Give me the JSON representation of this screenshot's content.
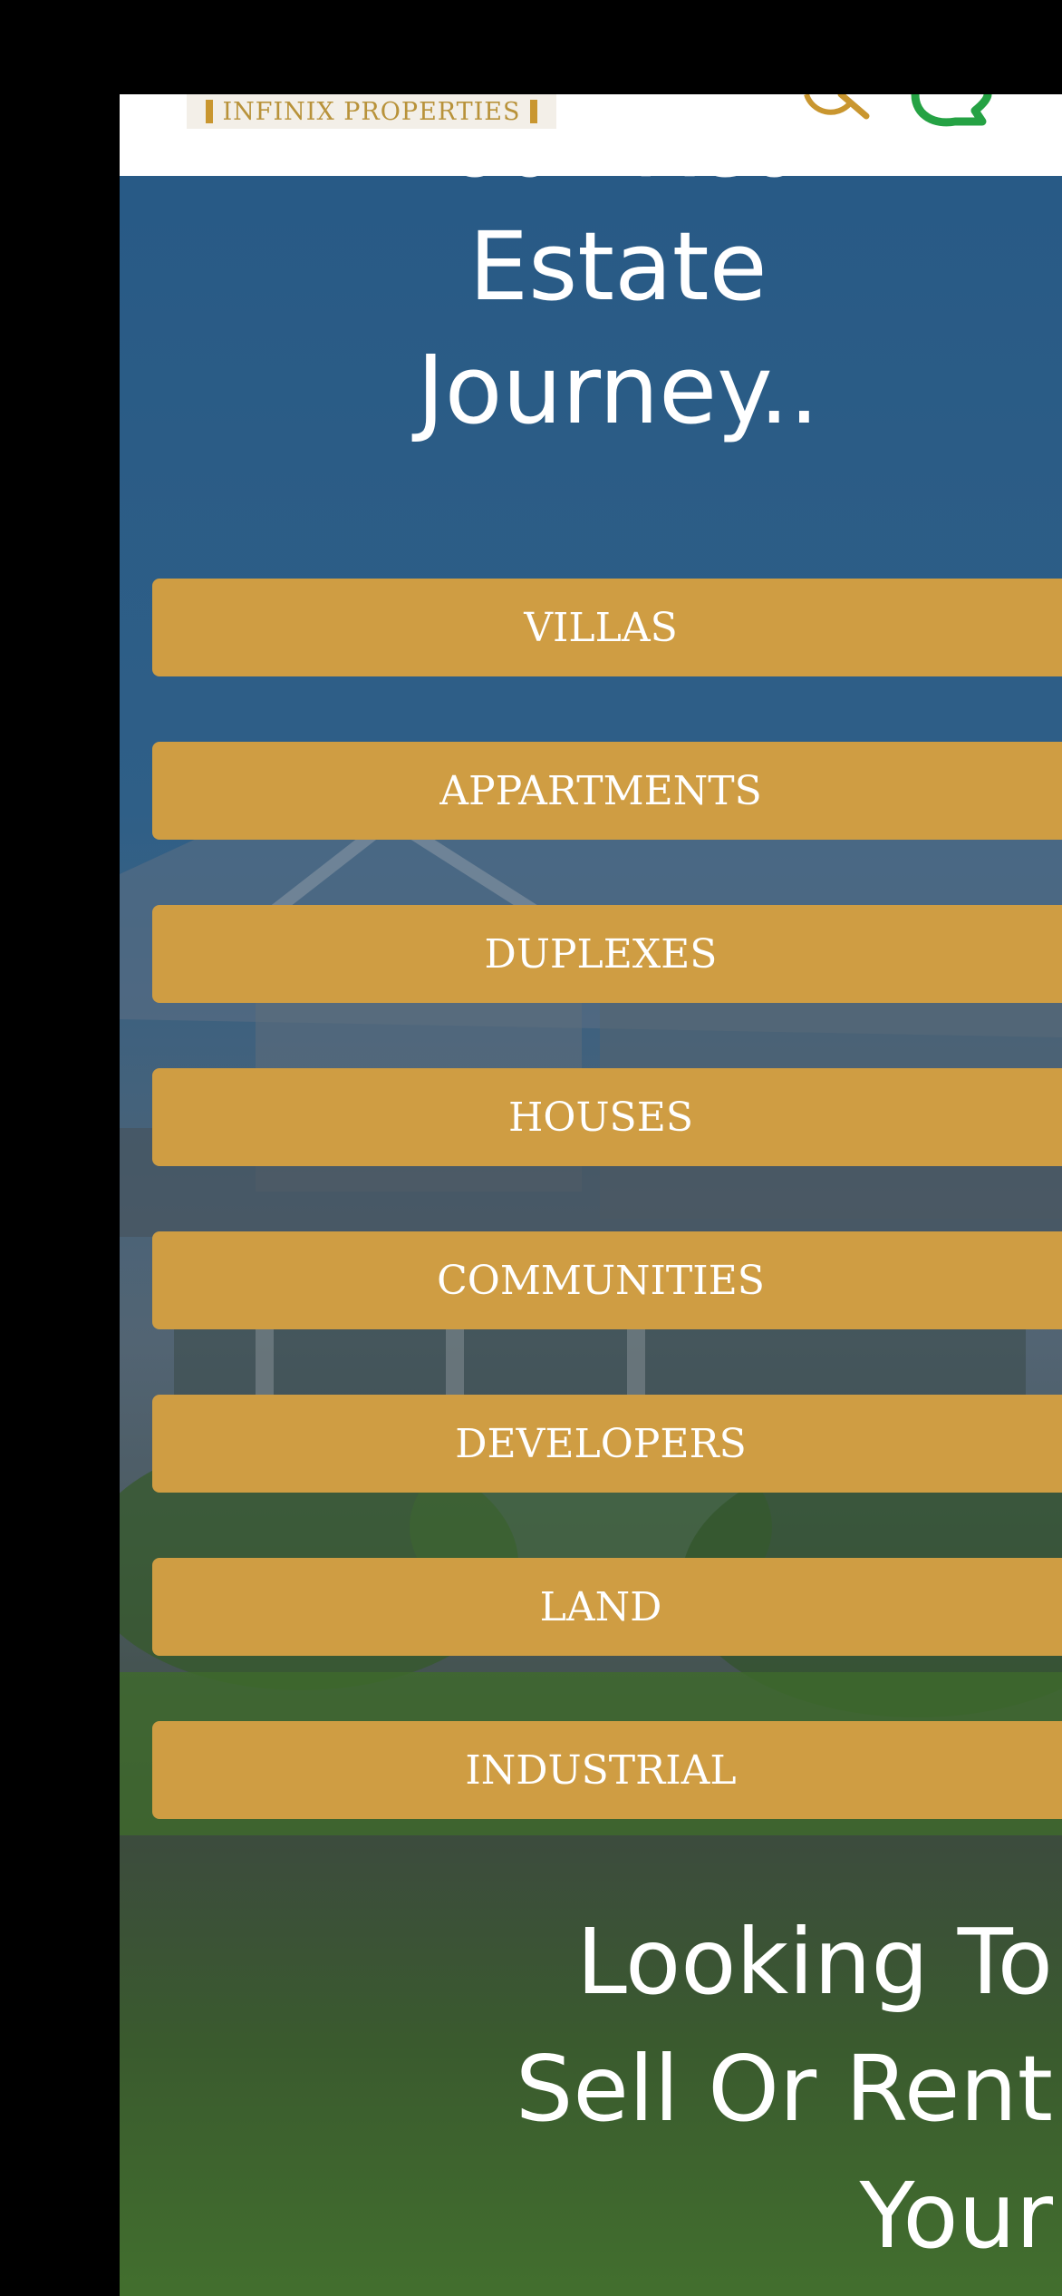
{
  "header": {
    "logo_text": "INFINIX PROPERTIES",
    "search_icon": "search-icon",
    "whatsapp_icon": "whatsapp-icon"
  },
  "hero": {
    "title_lines": [
      "Your Real",
      "Estate",
      "Journey.."
    ]
  },
  "categories": [
    {
      "label": "VILLAS"
    },
    {
      "label": "APPARTMENTS"
    },
    {
      "label": "DUPLEXES"
    },
    {
      "label": "HOUSES"
    },
    {
      "label": "COMMUNITIES"
    },
    {
      "label": "DEVELOPERS"
    },
    {
      "label": "LAND"
    },
    {
      "label": "INDUSTRIAL"
    }
  ],
  "sell": {
    "title_lines": [
      "Looking To",
      "Sell Or Rent",
      "Your"
    ]
  },
  "colors": {
    "accent": "#cf9d43",
    "hero_blue": "#2a5377",
    "logo_gold": "#b8923a",
    "whatsapp_green": "#25a244"
  }
}
